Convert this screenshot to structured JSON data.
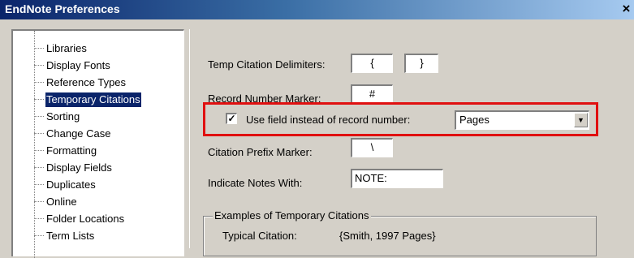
{
  "window": {
    "title": "EndNote Preferences",
    "close_glyph": "×"
  },
  "tree": {
    "items": [
      {
        "label": "Libraries"
      },
      {
        "label": "Display Fonts"
      },
      {
        "label": "Reference Types"
      },
      {
        "label": "Temporary Citations",
        "selected": true
      },
      {
        "label": "Sorting"
      },
      {
        "label": "Change Case"
      },
      {
        "label": "Formatting"
      },
      {
        "label": "Display Fields"
      },
      {
        "label": "Duplicates"
      },
      {
        "label": "Online"
      },
      {
        "label": "Folder Locations"
      },
      {
        "label": "Term Lists"
      }
    ]
  },
  "form": {
    "temp_citation_delimiters_label": "Temp Citation Delimiters:",
    "open_delimiter": "{",
    "close_delimiter": "}",
    "record_number_marker_label": "Record Number Marker:",
    "record_number_marker": "#",
    "use_field_label": "Use field instead of record number:",
    "use_field_checked": true,
    "use_field_value": "Pages",
    "citation_prefix_marker_label": "Citation Prefix Marker:",
    "citation_prefix_marker": "\\",
    "indicate_notes_label": "Indicate Notes With:",
    "indicate_notes_value": "NOTE:"
  },
  "examples": {
    "title": "Examples of Temporary Citations",
    "typical_label": "Typical Citation:",
    "typical_value": "{Smith, 1997 Pages}"
  },
  "colors": {
    "highlight": "#e01010",
    "selection": "#0a246a",
    "titlebar": "#0a246a"
  }
}
